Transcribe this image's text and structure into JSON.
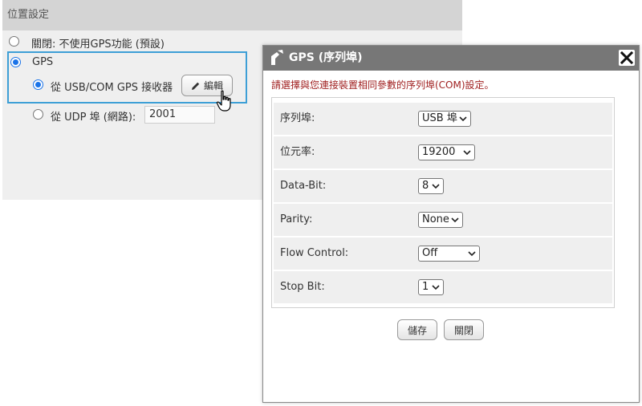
{
  "location_settings": {
    "header": "位置設定",
    "options": {
      "disabled_label": "關閉: 不使用GPS功能 (預設)",
      "gps_label": "GPS",
      "usb_com_label": "從 USB/COM GPS 接收器",
      "udp_label": "從 UDP 埠 (網路):",
      "udp_port_value": "2001",
      "edit_button_label": "編輯"
    },
    "selected": "gps",
    "gps_source_selected": "usb_com"
  },
  "dialog": {
    "title": "GPS (序列埠)",
    "description": "請選擇與您連接裝置相同參數的序列埠(COM)設定。",
    "fields": [
      {
        "label": "序列埠:",
        "value": "USB 埠"
      },
      {
        "label": "位元率:",
        "value": "19200"
      },
      {
        "label": "Data-Bit:",
        "value": "8"
      },
      {
        "label": "Parity:",
        "value": "None"
      },
      {
        "label": "Flow Control:",
        "value": "Off"
      },
      {
        "label": "Stop Bit:",
        "value": "1"
      }
    ],
    "save_label": "儲存",
    "close_label": "關閉"
  },
  "colors": {
    "accent_blue": "#1a73e8",
    "highlight_border": "#3d9fd6",
    "description_red": "#a02020",
    "titlebar_gray": "#777777"
  },
  "icons": {
    "edit": "pencil-icon",
    "dialog": "gps-device-icon",
    "close": "close-icon",
    "cursor": "hand-pointer-icon"
  }
}
